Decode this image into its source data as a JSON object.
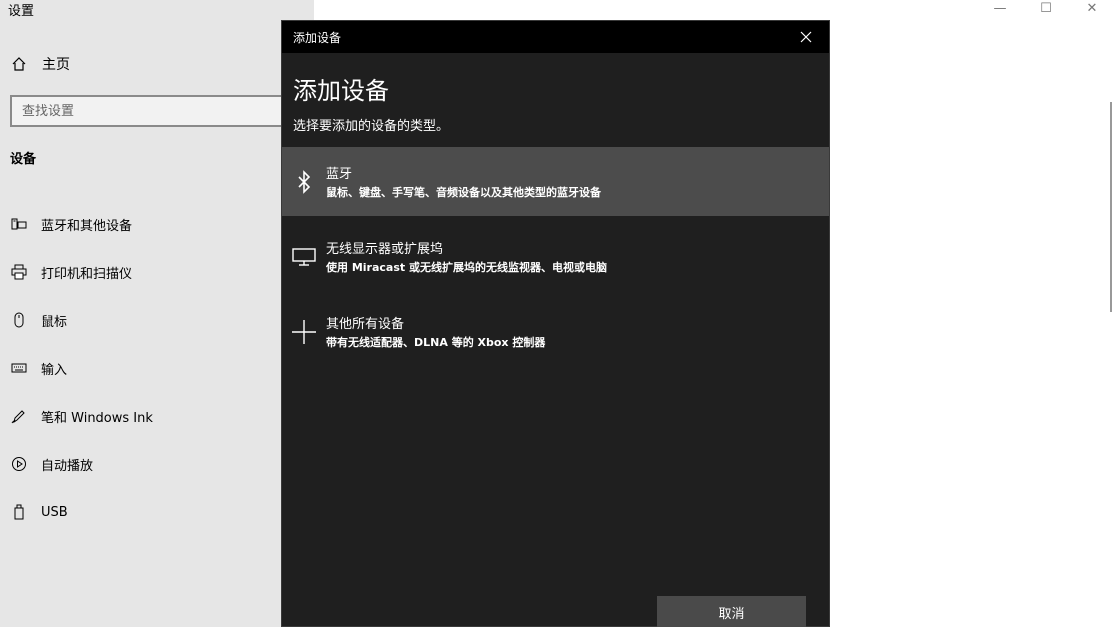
{
  "app": {
    "title": "设置",
    "home_label": "主页",
    "search_placeholder": "查找设置",
    "section_title": "设备",
    "nav_items": [
      {
        "label": "蓝牙和其他设备",
        "icon": "bluetooth-devices-icon"
      },
      {
        "label": "打印机和扫描仪",
        "icon": "printer-icon"
      },
      {
        "label": "鼠标",
        "icon": "mouse-icon"
      },
      {
        "label": "输入",
        "icon": "keyboard-icon"
      },
      {
        "label": "笔和 Windows Ink",
        "icon": "pen-icon"
      },
      {
        "label": "自动播放",
        "icon": "autoplay-icon"
      },
      {
        "label": "USB",
        "icon": "usb-icon"
      }
    ]
  },
  "window_controls": {
    "minimize": "—",
    "maximize": "☐",
    "close": "✕"
  },
  "dialog": {
    "titlebar": "添加设备",
    "heading": "添加设备",
    "subtitle": "选择要添加的设备的类型。",
    "options": [
      {
        "name": "蓝牙",
        "desc": "鼠标、键盘、手写笔、音频设备以及其他类型的蓝牙设备",
        "icon": "bluetooth-icon",
        "selected": true
      },
      {
        "name": "无线显示器或扩展坞",
        "desc": "使用 Miracast 或无线扩展坞的无线监视器、电视或电脑",
        "icon": "monitor-icon",
        "selected": false
      },
      {
        "name": "其他所有设备",
        "desc": "带有无线适配器、DLNA 等的 Xbox 控制器",
        "icon": "plus-icon",
        "selected": false
      }
    ],
    "cancel_label": "取消"
  },
  "colors": {
    "sidebar_bg": "#e6e6e6",
    "dialog_bg": "#1f1f1f",
    "selected_bg": "#4c4c4c",
    "button_bg": "#4a4a4a"
  }
}
